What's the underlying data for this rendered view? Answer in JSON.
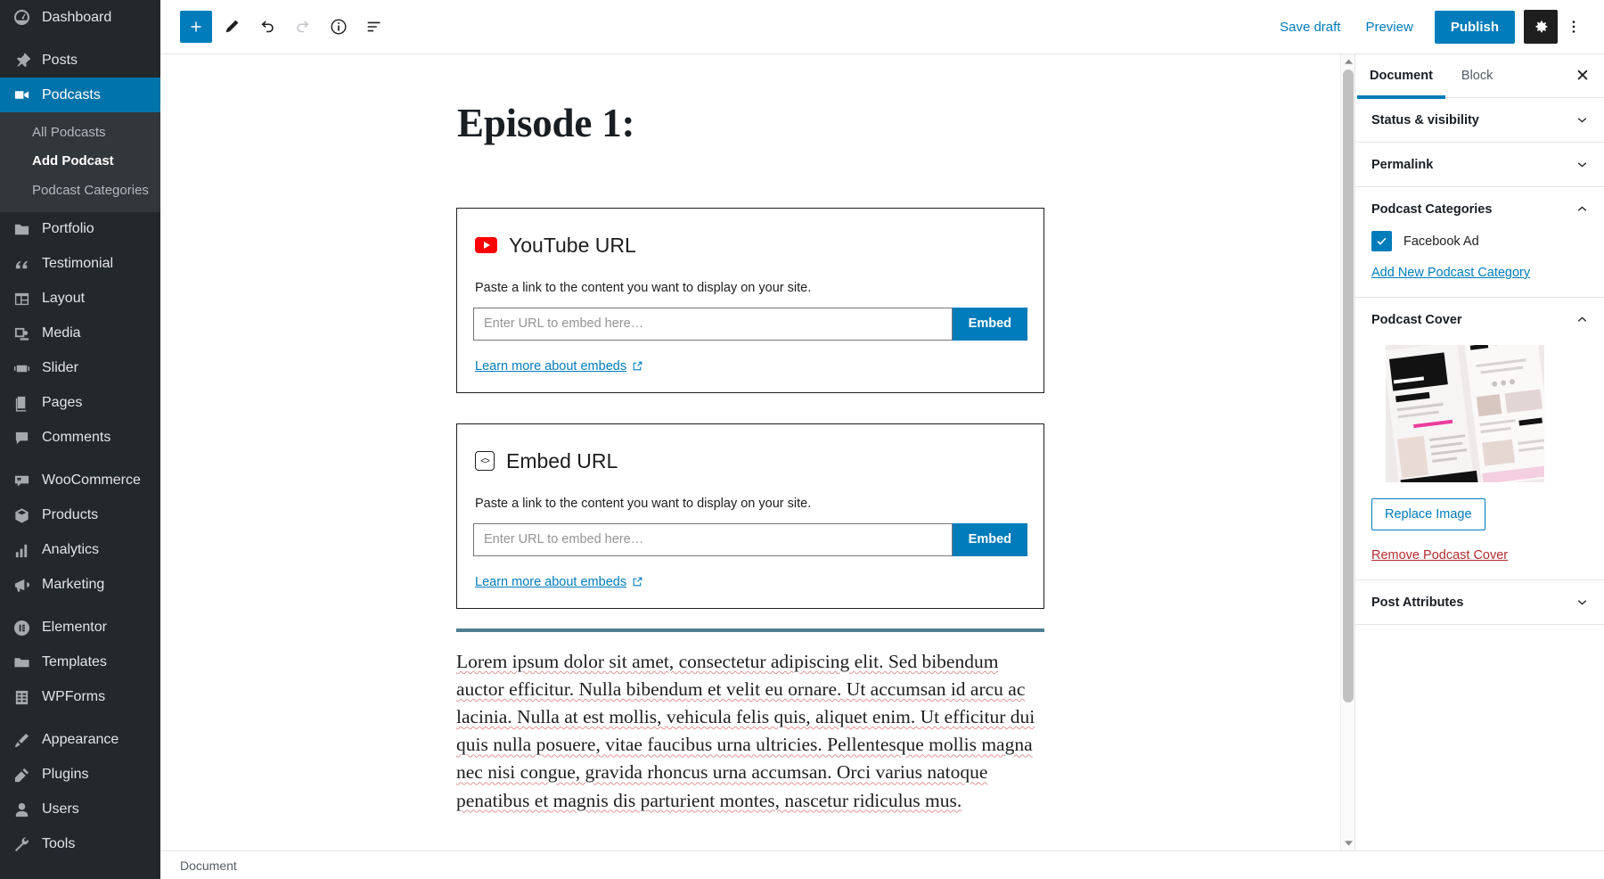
{
  "admin_sidebar": {
    "items": [
      {
        "label": "Dashboard",
        "icon": "dashboard-icon",
        "current": false,
        "sep_after": true
      },
      {
        "label": "Posts",
        "icon": "pin-icon",
        "current": false,
        "sep_after": false
      },
      {
        "label": "Podcasts",
        "icon": "video-camera-icon",
        "current": true,
        "sep_after": false
      },
      {
        "label": "Portfolio",
        "icon": "portfolio-icon",
        "current": false,
        "sep_after": false
      },
      {
        "label": "Testimonial",
        "icon": "quote-icon",
        "current": false,
        "sep_after": false
      },
      {
        "label": "Layout",
        "icon": "layout-icon",
        "current": false,
        "sep_after": false
      },
      {
        "label": "Media",
        "icon": "media-icon",
        "current": false,
        "sep_after": false
      },
      {
        "label": "Slider",
        "icon": "slider-icon",
        "current": false,
        "sep_after": false
      },
      {
        "label": "Pages",
        "icon": "pages-icon",
        "current": false,
        "sep_after": false
      },
      {
        "label": "Comments",
        "icon": "comments-icon",
        "current": false,
        "sep_after": true
      },
      {
        "label": "WooCommerce",
        "icon": "woocommerce-icon",
        "current": false,
        "sep_after": false
      },
      {
        "label": "Products",
        "icon": "products-icon",
        "current": false,
        "sep_after": false
      },
      {
        "label": "Analytics",
        "icon": "analytics-icon",
        "current": false,
        "sep_after": false
      },
      {
        "label": "Marketing",
        "icon": "marketing-icon",
        "current": false,
        "sep_after": true
      },
      {
        "label": "Elementor",
        "icon": "elementor-icon",
        "current": false,
        "sep_after": false
      },
      {
        "label": "Templates",
        "icon": "templates-icon",
        "current": false,
        "sep_after": false
      },
      {
        "label": "WPForms",
        "icon": "wpforms-icon",
        "current": false,
        "sep_after": true
      },
      {
        "label": "Appearance",
        "icon": "appearance-icon",
        "current": false,
        "sep_after": false
      },
      {
        "label": "Plugins",
        "icon": "plugins-icon",
        "current": false,
        "sep_after": false
      },
      {
        "label": "Users",
        "icon": "users-icon",
        "current": false,
        "sep_after": false
      },
      {
        "label": "Tools",
        "icon": "tools-icon",
        "current": false,
        "sep_after": false
      }
    ],
    "submenu": [
      {
        "label": "All Podcasts",
        "current": false
      },
      {
        "label": "Add Podcast",
        "current": true
      },
      {
        "label": "Podcast Categories",
        "current": false
      }
    ]
  },
  "toolbar": {
    "add_block_label": "+",
    "tools": [
      {
        "name": "add-block-button",
        "title": "Add block"
      },
      {
        "name": "edit-mode-button",
        "title": "Tools"
      },
      {
        "name": "undo-button",
        "title": "Undo"
      },
      {
        "name": "redo-button",
        "title": "Redo"
      },
      {
        "name": "details-button",
        "title": "Content structure"
      },
      {
        "name": "list-view-button",
        "title": "Block navigation"
      }
    ],
    "save_draft_label": "Save draft",
    "preview_label": "Preview",
    "publish_label": "Publish",
    "settings_title": "Settings",
    "more_title": "More tools & options"
  },
  "editor": {
    "post_title": "Episode 1:",
    "blocks": [
      {
        "icon": "youtube-icon",
        "title": "YouTube URL",
        "description": "Paste a link to the content you want to display on your site.",
        "input_placeholder": "Enter URL to embed here…",
        "submit_label": "Embed",
        "learn_more_label": "Learn more about embeds"
      },
      {
        "icon": "embed-code-icon",
        "title": "Embed URL",
        "description": "Paste a link to the content you want to display on your site.",
        "input_placeholder": "Enter URL to embed here…",
        "submit_label": "Embed",
        "learn_more_label": "Learn more about embeds"
      }
    ],
    "paragraph": "Lorem ipsum dolor sit amet, consectetur adipiscing elit. Sed bibendum auctor efficitur. Nulla bibendum et velit eu ornare. Ut accumsan id arcu ac lacinia. Nulla at est mollis, vehicula felis quis, aliquet enim. Ut efficitur dui quis nulla posuere, vitae faucibus urna ultricies. Pellentesque mollis magna nec nisi congue, gravida rhoncus urna accumsan. Orci varius natoque penatibus et magnis dis parturient montes, nascetur ridiculus mus."
  },
  "settings": {
    "tabs": [
      {
        "label": "Document",
        "active": true
      },
      {
        "label": "Block",
        "active": false
      }
    ],
    "close_label": "✕",
    "panels": [
      {
        "title": "Status & visibility",
        "open": false
      },
      {
        "title": "Permalink",
        "open": false
      },
      {
        "title": "Podcast Categories",
        "open": true
      },
      {
        "title": "Podcast Cover",
        "open": true
      },
      {
        "title": "Post Attributes",
        "open": false
      }
    ],
    "categories": {
      "checkbox_label": "Facebook Ad",
      "checked": true,
      "add_new_label": "Add New Podcast Category"
    },
    "cover": {
      "replace_label": "Replace Image",
      "remove_label": "Remove Podcast Cover"
    }
  },
  "status_bar": {
    "label": "Document"
  },
  "colors": {
    "accent_blue": "#007cba",
    "sidebar_bg": "#23282d",
    "submenu_bg": "#32373c",
    "current_blue": "#0073aa",
    "danger_red": "#b32d2e",
    "youtube_red": "#ff0000",
    "separator_blue": "#4f7f93"
  }
}
